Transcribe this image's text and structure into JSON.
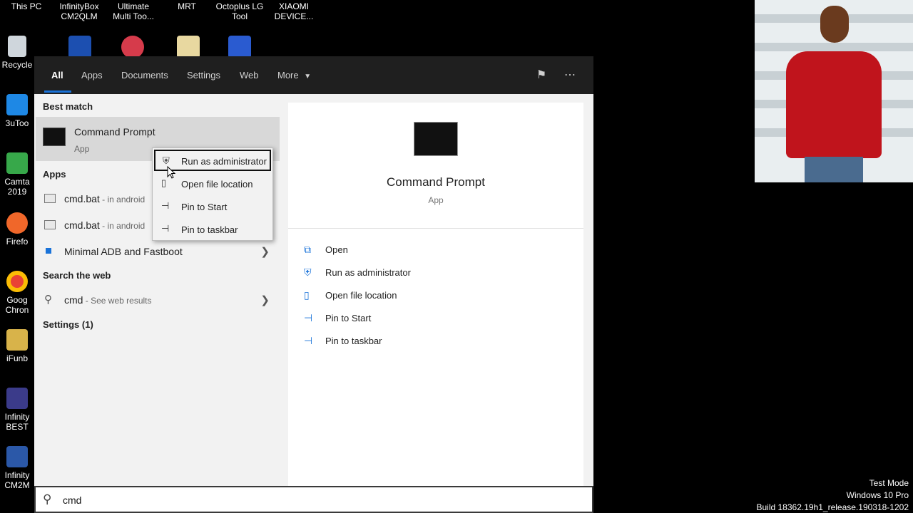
{
  "desktop": {
    "top_icons": [
      {
        "label_line1": "This PC",
        "label_line2": ""
      },
      {
        "label_line1": "InfinityBox",
        "label_line2": "CM2QLM"
      },
      {
        "label_line1": "Ultimate",
        "label_line2": "Multi Too..."
      },
      {
        "label_line1": "MRT",
        "label_line2": ""
      },
      {
        "label_line1": "Octoplus LG",
        "label_line2": "Tool"
      },
      {
        "label_line1": "XIAOMI",
        "label_line2": "DEVICE..."
      }
    ],
    "side_icons": [
      {
        "label": "Recycle"
      },
      {
        "label": "3uToo"
      },
      {
        "label": "Camta\n2019"
      },
      {
        "label": "Firefo"
      },
      {
        "label": "Goog\nChron"
      },
      {
        "label": "iFunb"
      },
      {
        "label": "Infinity\nBEST"
      },
      {
        "label": "Infinity\nCM2M"
      }
    ]
  },
  "tabs": {
    "all": "All",
    "apps": "Apps",
    "documents": "Documents",
    "settings": "Settings",
    "web": "Web",
    "more": "More",
    "more_icon": "caret-down"
  },
  "left": {
    "best_match_heading": "Best match",
    "best_match": {
      "title": "Command Prompt",
      "subtitle": "App"
    },
    "apps_heading": "Apps",
    "apps": [
      {
        "title": "cmd.bat",
        "subtitle": " - in android"
      },
      {
        "title": "cmd.bat",
        "subtitle": " - in android"
      },
      {
        "title": "Minimal ADB and Fastboot",
        "subtitle": ""
      }
    ],
    "search_web_heading": "Search the web",
    "web_result": {
      "title": "cmd",
      "subtitle": " - See web results"
    },
    "settings_heading": "Settings (1)"
  },
  "context_menu": {
    "items": [
      {
        "label": "Run as administrator",
        "icon": "shield-icon"
      },
      {
        "label": "Open file location",
        "icon": "file-location-icon"
      },
      {
        "label": "Pin to Start",
        "icon": "pin-icon"
      },
      {
        "label": "Pin to taskbar",
        "icon": "pin-icon"
      }
    ]
  },
  "right": {
    "title": "Command Prompt",
    "subtitle": "App",
    "actions": [
      {
        "label": "Open",
        "icon": "open-icon"
      },
      {
        "label": "Run as administrator",
        "icon": "shield-icon"
      },
      {
        "label": "Open file location",
        "icon": "file-location-icon"
      },
      {
        "label": "Pin to Start",
        "icon": "pin-icon"
      },
      {
        "label": "Pin to taskbar",
        "icon": "pin-icon"
      }
    ]
  },
  "search": {
    "value": "cmd"
  },
  "watermark": {
    "line1": "Test Mode",
    "line2": "Windows 10 Pro",
    "line3": "Build 18362.19h1_release.190318-1202"
  }
}
